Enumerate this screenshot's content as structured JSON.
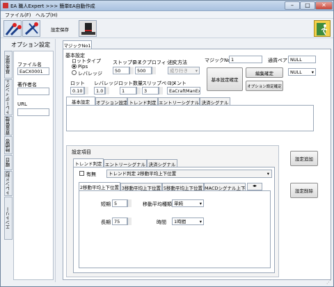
{
  "window": {
    "title": "EA 職人Expert >>> 簡単EA自動作成"
  },
  "menu": [
    "ファイル(F)",
    "ヘルプ(H)"
  ],
  "toolbar": {
    "setting_save_label": "設定保存"
  },
  "sidebar": {
    "header": "オプション設定",
    "vtabs": [
      "基本設定",
      "トレーディングルール",
      "資金管理",
      "時間帯",
      "曜日",
      "トレンド判定",
      "エントリー"
    ],
    "filename_label": "ファイル名",
    "filename_value": "EaCX0001",
    "author_label": "著作者名",
    "author_value": "",
    "url_label": "URL",
    "url_value": ""
  },
  "magic_tab": "マジックNo1",
  "basic": {
    "header": "基本設定",
    "lot_type_label": "ロットタイプ",
    "lot_type_options": [
      "Pips",
      "レバレッジ"
    ],
    "stoploss_label": "ストップロス",
    "stoploss_value": "50",
    "takeprofit_label": "テイクプロフィット",
    "takeprofit_value": "500",
    "order_method_label": "注文方法",
    "order_method_value": "成り行き",
    "lot_label": "ロット",
    "lot_value": "0.10",
    "leverage_label": "レバレッジ",
    "leverage_value": "1.0",
    "lot_count_label": "ロット数量",
    "lot_count_value": "1",
    "slippage_label": "スリップページ",
    "slippage_value": "3",
    "comment_label": "コメント",
    "comment_value": "EaCraftManExp"
  },
  "magic": {
    "label": "マジックNo",
    "value": "1",
    "pair_label": "通貨ペア",
    "pair_value": "NULL",
    "pair2_value": "NULL"
  },
  "buttons": {
    "basic_confirm": "基本設定確定",
    "edit_confirm": "編集確定",
    "option_confirm": "オプション設定確定",
    "add": "設定追加",
    "delete": "設定削除"
  },
  "sub_tabs": [
    "基本設定",
    "オプション設定",
    "トレンド判定",
    "エントリーシグナル",
    "決済シグナル"
  ],
  "settings": {
    "header": "設定項目",
    "tabs": [
      "トレンド判定",
      "エントリーシグナル",
      "決済シグナル"
    ],
    "enable_label": "有無",
    "trend_select": "トレンド判定 2移動平均上下位置",
    "inner_tabs": [
      "2移動平均上下位置",
      "3移動平均上下位置",
      "5移動平均上下位置",
      "MACDシグナル上下"
    ],
    "short_label": "短期",
    "short_value": "5",
    "long_label": "長期",
    "long_value": "75",
    "ma_type_label": "移動平均種類",
    "ma_type_value": "単純",
    "time_label": "時間",
    "time_value": "1時間"
  },
  "colors": {
    "accent": "#3a6ea5"
  }
}
